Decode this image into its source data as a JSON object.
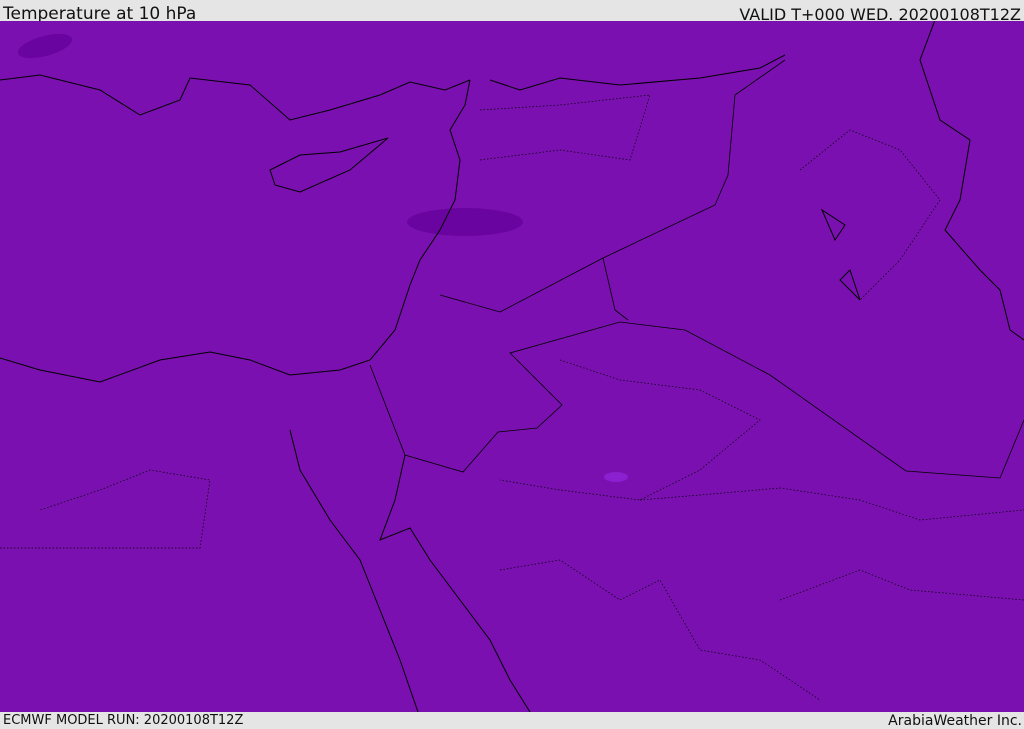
{
  "header": {
    "title": "Temperature at 10 hPa",
    "valid": "VALID T+000 WED. 20200108T12Z"
  },
  "footer": {
    "model_run": "ECMWF MODEL RUN: 20200108T12Z",
    "credit": "ArabiaWeather Inc."
  },
  "colors": {
    "field": "#7a10b0",
    "cold_patch": "#6a04a0",
    "warm_patch": "#8a20d0",
    "coast": "#000000"
  }
}
